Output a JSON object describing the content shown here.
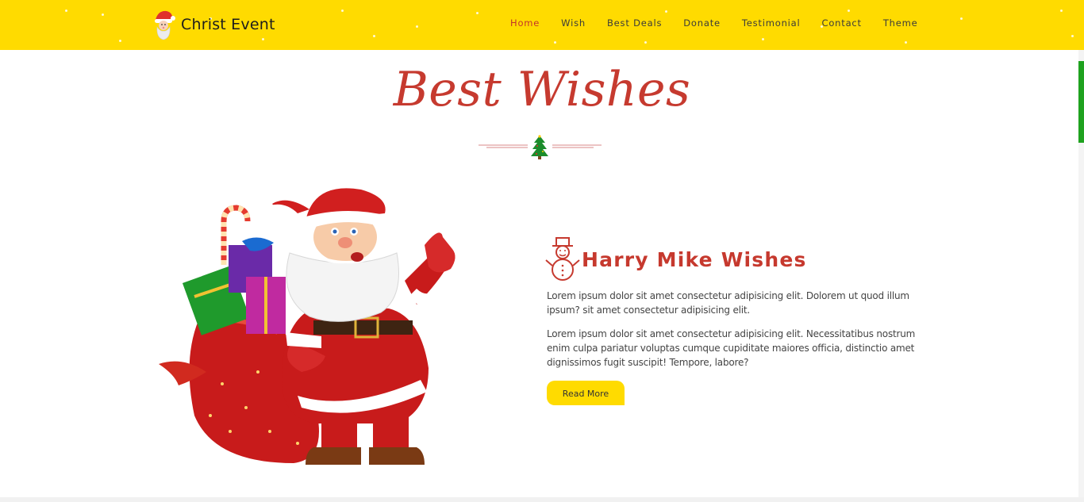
{
  "brand": {
    "name": "Christ Event",
    "icon": "santa-face-icon"
  },
  "nav": {
    "items": [
      "Home",
      "Wish",
      "Best Deals",
      "Donate",
      "Testimonial",
      "Contact",
      "Theme"
    ],
    "active": "Home"
  },
  "section": {
    "title": "Best Wishes",
    "divider_icon": "christmas-tree-icon"
  },
  "wish": {
    "icon": "snowman-icon",
    "heading": "Harry Mike Wishes",
    "paragraph_1": "Lorem ipsum dolor sit amet consectetur adipisicing elit. Dolorem ut quod illum ipsum? sit amet consectetur adipisicing elit.",
    "paragraph_2": "Lorem ipsum dolor sit amet consectetur adipisicing elit. Necessitatibus nostrum enim culpa pariatur voluptas cumque cupiditate maiores officia, distinctio amet dignissimos fugit suscipit! Tempore, labore?",
    "button_label": "Read More"
  },
  "colors": {
    "header_bg": "#ffdb00",
    "accent_red": "#c63a2f",
    "button_bg": "#ffdb00",
    "scroll_indicator": "#1fa21f"
  }
}
